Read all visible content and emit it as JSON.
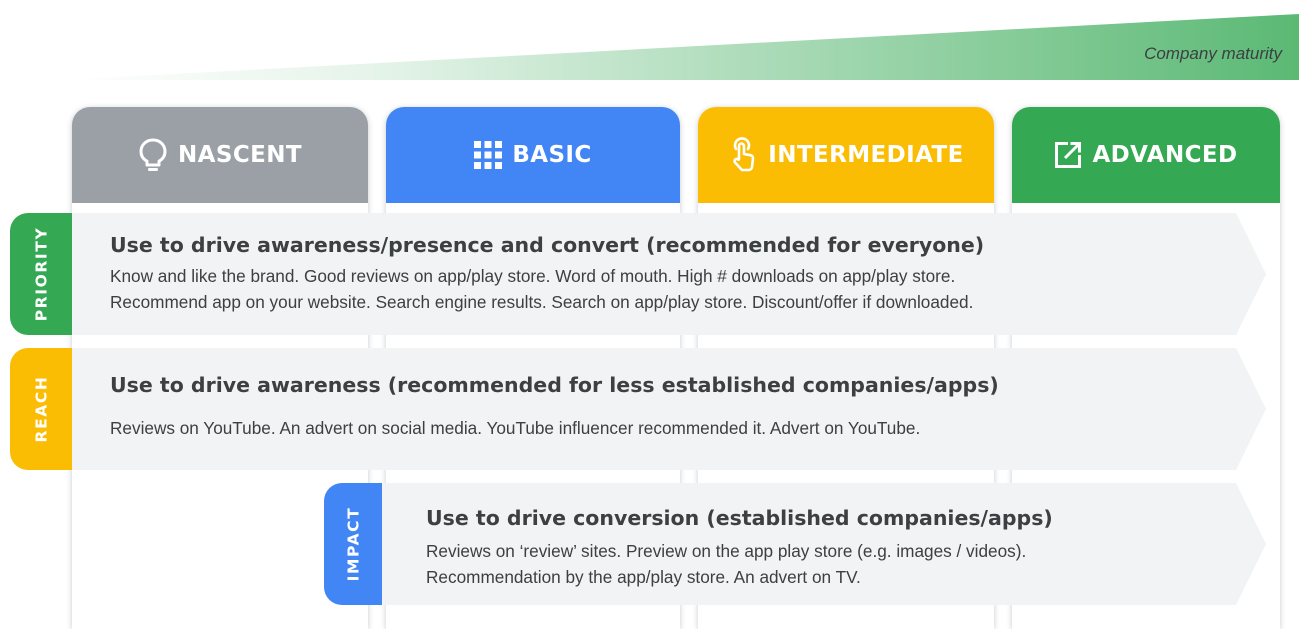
{
  "header": {
    "maturity_label": "Company maturity",
    "wedge_colors": {
      "start": "#e6f4ea",
      "end": "#5bb974"
    }
  },
  "stages": [
    {
      "label": "NASCENT",
      "icon": "lightbulb-icon",
      "color": "#9aa0a6"
    },
    {
      "label": "BASIC",
      "icon": "grid-icon",
      "color": "#4285f4"
    },
    {
      "label": "INTERMEDIATE",
      "icon": "touch-icon",
      "color": "#fbbc04"
    },
    {
      "label": "ADVANCED",
      "icon": "open-in-new-icon",
      "color": "#34a853"
    }
  ],
  "rows": [
    {
      "tab": "PRIORITY",
      "tab_color": "#34a853",
      "title": "Use to drive awareness/presence and convert (recommended for everyone)",
      "lines": [
        "Know and like the brand. Good reviews on app/play store. Word of mouth. High # downloads on app/play store.",
        "Recommend app on your website. Search engine results. Search on app/play store. Discount/offer if downloaded."
      ]
    },
    {
      "tab": "REACH",
      "tab_color": "#fbbc04",
      "title": "Use to drive awareness (recommended for less established companies/apps)",
      "lines": [
        "Reviews on YouTube. An advert on social media. YouTube influencer recommended it. Advert on YouTube."
      ]
    },
    {
      "tab": "IMPACT",
      "tab_color": "#4285f4",
      "title": "Use to drive conversion (established companies/apps)",
      "lines": [
        "Reviews on ‘review’ sites. Preview on the app play store (e.g. images / videos).",
        "Recommendation by the app/play store. An advert on TV."
      ]
    }
  ]
}
